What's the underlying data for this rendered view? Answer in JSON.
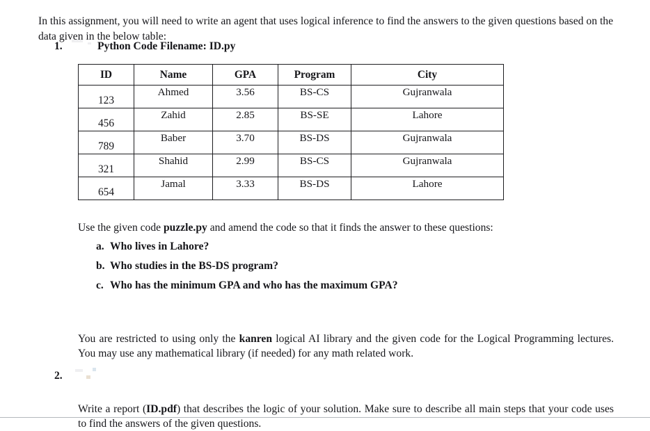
{
  "document": {
    "intro_paragraph": "In this assignment, you will need to write an agent that uses logical inference to find the answers to the given questions based on the data given in the below table:",
    "items": [
      {
        "number": "1.",
        "title": "Python Code Filename: ID.py"
      },
      {
        "number": "2.",
        "body_prefix": "Write a report (",
        "body_bold": "ID.pdf",
        "body_suffix": ") that describes the logic of your solution. Make sure to describe all main steps that your code uses to find the answers of the given questions."
      }
    ],
    "table": {
      "headers": [
        "ID",
        "Name",
        "GPA",
        "Program",
        "City"
      ],
      "rows": [
        {
          "id": "123",
          "name": "Ahmed",
          "gpa": "3.56",
          "program": "BS-CS",
          "city": "Gujranwala"
        },
        {
          "id": "456",
          "name": "Zahid",
          "gpa": "2.85",
          "program": "BS-SE",
          "city": "Lahore"
        },
        {
          "id": "789",
          "name": "Baber",
          "gpa": "3.70",
          "program": "BS-DS",
          "city": "Gujranwala"
        },
        {
          "id": "321",
          "name": "Shahid",
          "gpa": "2.99",
          "program": "BS-CS",
          "city": "Gujranwala"
        },
        {
          "id": "654",
          "name": "Jamal",
          "gpa": "3.33",
          "program": "BS-DS",
          "city": "Lahore"
        }
      ]
    },
    "use_code_line": {
      "prefix": "Use the given code ",
      "bold": "puzzle.py",
      "suffix": " and amend the code so that it finds the answer to these questions:"
    },
    "questions": [
      {
        "marker": "a.",
        "text": "Who lives in Lahore?"
      },
      {
        "marker": "b.",
        "text": "Who studies in the BS-DS program?"
      },
      {
        "marker": "c.",
        "text": "Who has the minimum GPA and who has the maximum GPA?"
      }
    ],
    "restriction_paragraph": {
      "prefix": "You are restricted to using only the ",
      "bold": "kanren",
      "suffix": " logical AI library and the given code for the Logical Programming lectures. You may use any mathematical library (if needed) for any math related work."
    }
  }
}
